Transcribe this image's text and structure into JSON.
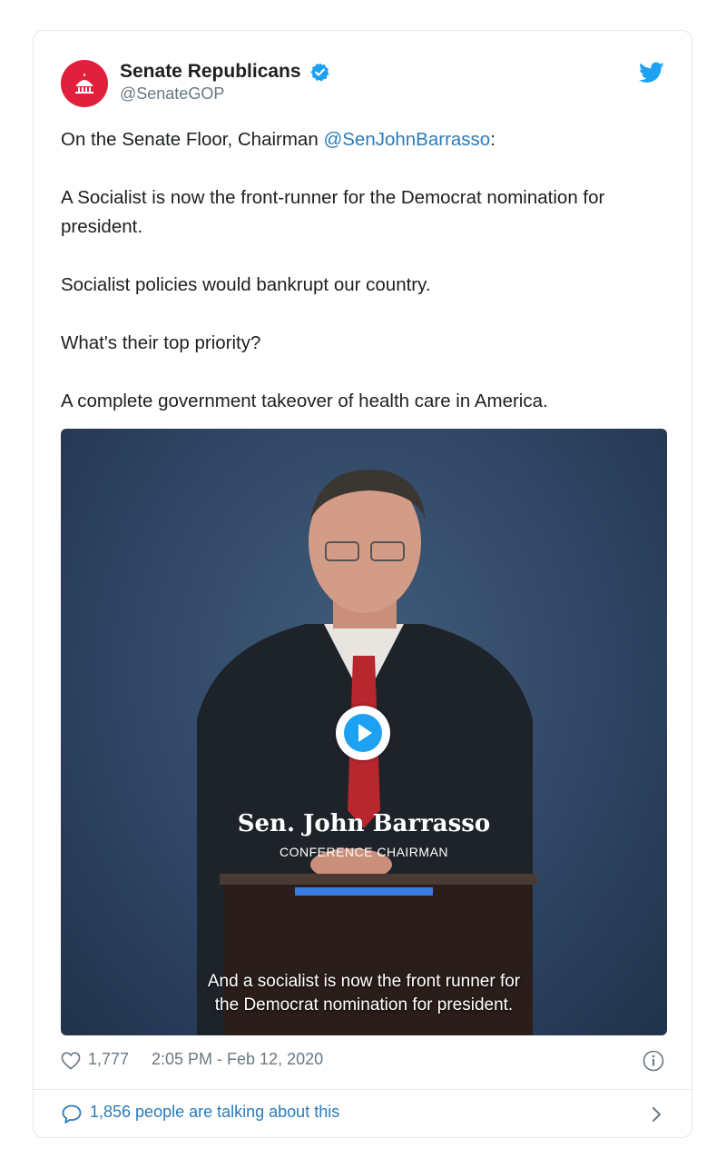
{
  "account": {
    "display_name": "Senate Republicans",
    "handle": "@SenateGOP",
    "avatar_color": "#e0203c",
    "verified_color": "#1da1f2"
  },
  "tweet": {
    "line1_prefix": "On the Senate Floor, Chairman ",
    "line1_mention": "@SenJohnBarrasso",
    "line1_suffix": ":",
    "p2": "A Socialist is now the front-runner for the Democrat nomination for president.",
    "p3": "Socialist policies would bankrupt our country.",
    "p4": "What's their top priority?",
    "p5": "A complete government takeover of health care in America."
  },
  "media": {
    "lower_third_name": "Sen. John Barrasso",
    "lower_third_title": "CONFERENCE CHAIRMAN",
    "caption_line1": "And a socialist is now the front runner for",
    "caption_line2": "the Democrat nomination for president."
  },
  "footer": {
    "likes": "1,777",
    "timestamp": "2:05 PM - Feb 12, 2020",
    "talking": "1,856 people are talking about this"
  },
  "colors": {
    "link": "#2b7bb9",
    "muted": "#697882",
    "border": "#e1e8ed",
    "twitter_blue": "#1da1f2"
  }
}
